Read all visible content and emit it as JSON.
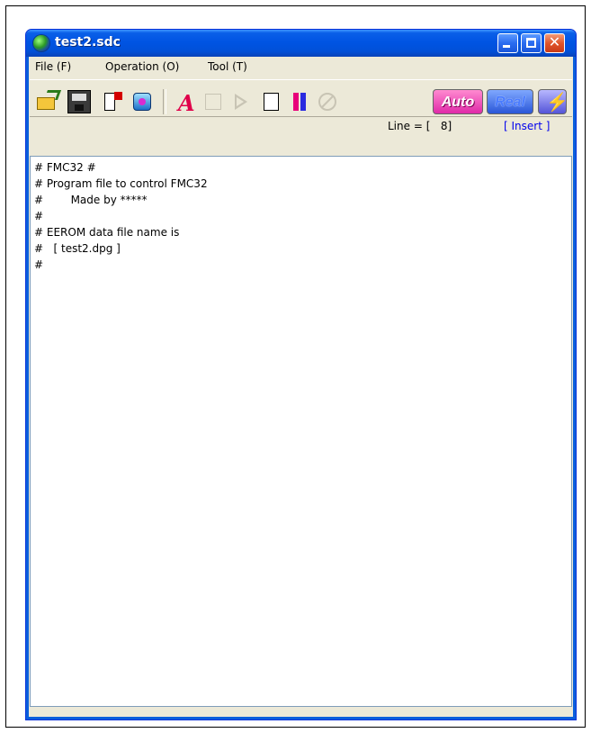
{
  "window": {
    "title": "test2.sdc"
  },
  "menubar": {
    "items": [
      {
        "label": "File (F)"
      },
      {
        "label": "Operation (O)"
      },
      {
        "label": "Tool (T)"
      }
    ]
  },
  "toolbar": {
    "buttons": [
      {
        "icon": "open-folder-icon"
      },
      {
        "icon": "save-icon"
      },
      {
        "icon": "list-icon"
      },
      {
        "icon": "database-icon"
      },
      {
        "icon": "font-a-icon"
      },
      {
        "icon": "disabled-edit-icon"
      },
      {
        "icon": "play-icon"
      },
      {
        "icon": "page-icon"
      },
      {
        "icon": "pause-icon"
      },
      {
        "icon": "stop-icon"
      }
    ],
    "auto_label": "Auto",
    "real_label": "Real",
    "flash_icon": "lightning-icon"
  },
  "status": {
    "line": "Line = [   8]",
    "mode": "[ Insert ]"
  },
  "editor": {
    "lines": [
      "# FMC32 #",
      "# Program file to control FMC32",
      "#        Made by *****",
      "#",
      "# EEROM data file name is",
      "#   [ test2.dpg ]",
      "#"
    ]
  }
}
